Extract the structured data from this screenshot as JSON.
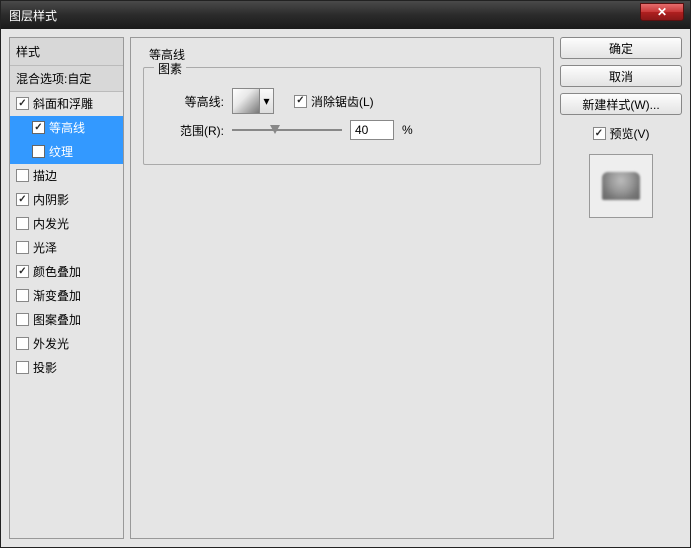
{
  "window": {
    "title": "图层样式"
  },
  "sidebar": {
    "header": "样式",
    "blend": "混合选项:自定",
    "items": [
      {
        "label": "斜面和浮雕",
        "checked": true,
        "indent": false,
        "selected": false
      },
      {
        "label": "等高线",
        "checked": true,
        "indent": true,
        "selected": true
      },
      {
        "label": "纹理",
        "checked": false,
        "indent": true,
        "selected": true
      },
      {
        "label": "描边",
        "checked": false,
        "indent": false,
        "selected": false
      },
      {
        "label": "内阴影",
        "checked": true,
        "indent": false,
        "selected": false
      },
      {
        "label": "内发光",
        "checked": false,
        "indent": false,
        "selected": false
      },
      {
        "label": "光泽",
        "checked": false,
        "indent": false,
        "selected": false
      },
      {
        "label": "颜色叠加",
        "checked": true,
        "indent": false,
        "selected": false
      },
      {
        "label": "渐变叠加",
        "checked": false,
        "indent": false,
        "selected": false
      },
      {
        "label": "图案叠加",
        "checked": false,
        "indent": false,
        "selected": false
      },
      {
        "label": "外发光",
        "checked": false,
        "indent": false,
        "selected": false
      },
      {
        "label": "投影",
        "checked": false,
        "indent": false,
        "selected": false
      }
    ]
  },
  "main": {
    "title": "等高线",
    "fieldset": "图素",
    "contour_label": "等高线:",
    "antialias_label": "消除锯齿(L)",
    "antialias_checked": true,
    "range_label": "范围(R):",
    "range_value": "40",
    "range_unit": "%"
  },
  "buttons": {
    "ok": "确定",
    "cancel": "取消",
    "new_style": "新建样式(W)...",
    "preview_label": "预览(V)",
    "preview_checked": true
  }
}
